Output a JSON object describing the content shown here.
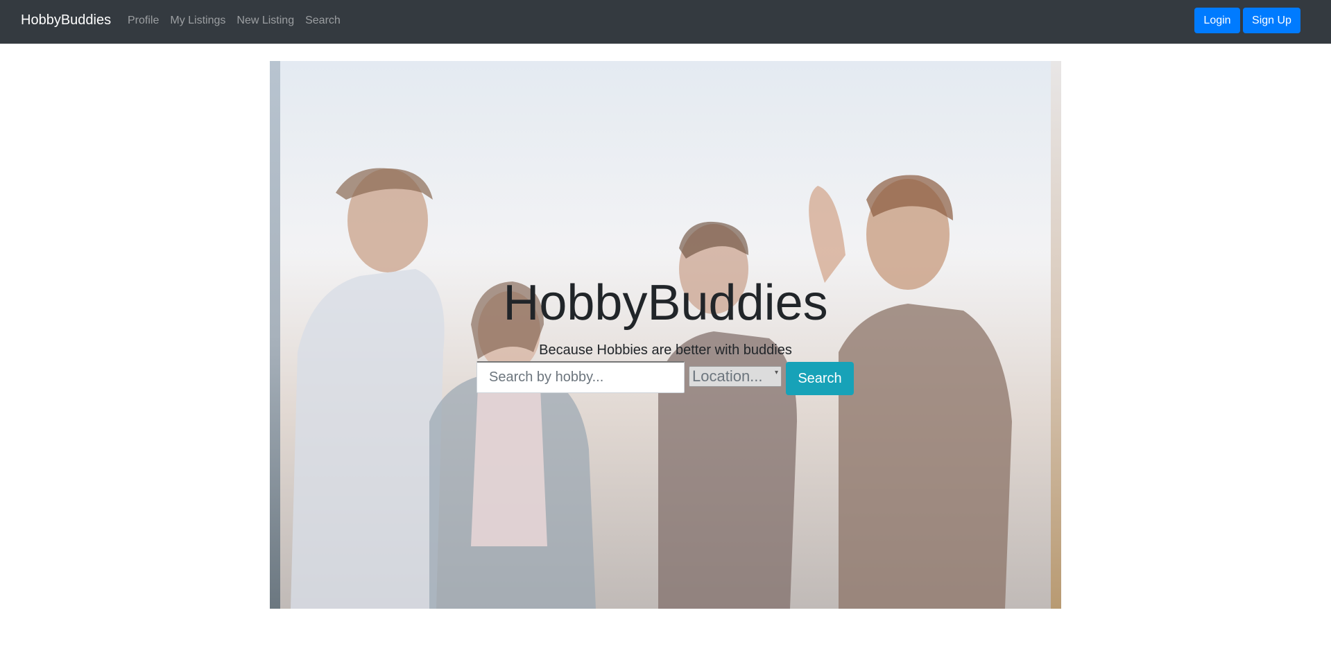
{
  "navbar": {
    "brand": "HobbyBuddies",
    "links": [
      "Profile",
      "My Listings",
      "New Listing",
      "Search"
    ],
    "login_label": "Login",
    "signup_label": "Sign Up"
  },
  "hero": {
    "title": "HobbyBuddies",
    "subtitle": "Because Hobbies are better with buddies",
    "search_placeholder": "Search by hobby...",
    "location_label": "Location...",
    "search_button": "Search"
  },
  "colors": {
    "navbar_bg": "#343a40",
    "primary": "#007bff",
    "info": "#17a2b8"
  }
}
